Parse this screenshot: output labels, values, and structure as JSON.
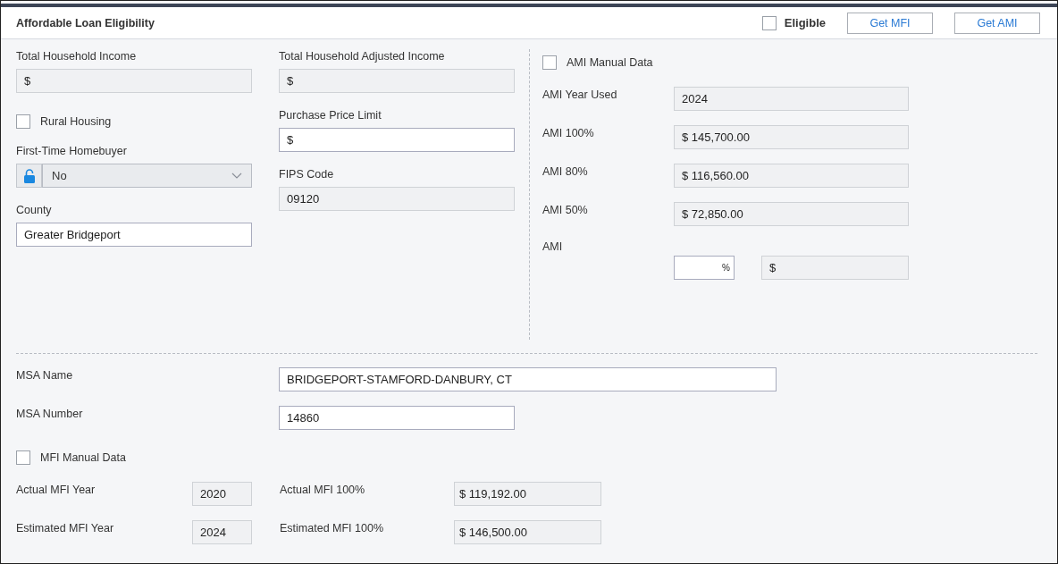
{
  "header": {
    "title": "Affordable Loan Eligibility",
    "eligible": {
      "label": "Eligible",
      "checked": false
    },
    "buttons": [
      "Get MFI",
      "Get AMI"
    ]
  },
  "left": [
    {
      "kind": "field",
      "label": "Total Household Income",
      "value": "$",
      "readonly": true
    },
    {
      "kind": "checkbox",
      "label": "Rural Housing",
      "checked": false
    },
    {
      "kind": "select",
      "label": "First-Time Homebuyer",
      "value": "No",
      "locked": false
    },
    {
      "kind": "field",
      "label": "County",
      "value": "Greater Bridgeport",
      "readonly": false
    }
  ],
  "middle": [
    {
      "kind": "field",
      "label": "Total Household Adjusted Income",
      "value": "$",
      "readonly": true
    },
    {
      "kind": "field",
      "label": "Purchase Price Limit",
      "value": "$",
      "readonly": false
    },
    {
      "kind": "field",
      "label": "FIPS Code",
      "value": "09120",
      "readonly": true
    }
  ],
  "ami": {
    "manual": {
      "label": "AMI Manual Data",
      "checked": false
    },
    "rows": [
      {
        "label": "AMI Year Used",
        "value": "2024",
        "readonly": true
      },
      {
        "label": "AMI 100%",
        "value": "$ 145,700.00",
        "readonly": true
      },
      {
        "label": "AMI 80%",
        "value": "$ 116,560.00",
        "readonly": true
      },
      {
        "label": "AMI 50%",
        "value": "$ 72,850.00",
        "readonly": true
      }
    ],
    "custom": {
      "label": "AMI",
      "percent_unit": "%",
      "amount": "$"
    }
  },
  "msa": [
    {
      "label": "MSA Name",
      "value": "BRIDGEPORT-STAMFORD-DANBURY, CT",
      "readonly": false
    },
    {
      "label": "MSA Number",
      "value": "14860",
      "readonly": false
    }
  ],
  "mfi": {
    "manual": {
      "label": "MFI Manual Data",
      "checked": false
    },
    "rows": [
      {
        "label": "Actual MFI Year",
        "year": "2020",
        "amount_label": "Actual MFI 100%",
        "amount": "$ 119,192.00"
      },
      {
        "label": "Estimated MFI Year",
        "year": "2024",
        "amount_label": "Estimated MFI 100%",
        "amount": "$ 146,500.00"
      }
    ]
  }
}
